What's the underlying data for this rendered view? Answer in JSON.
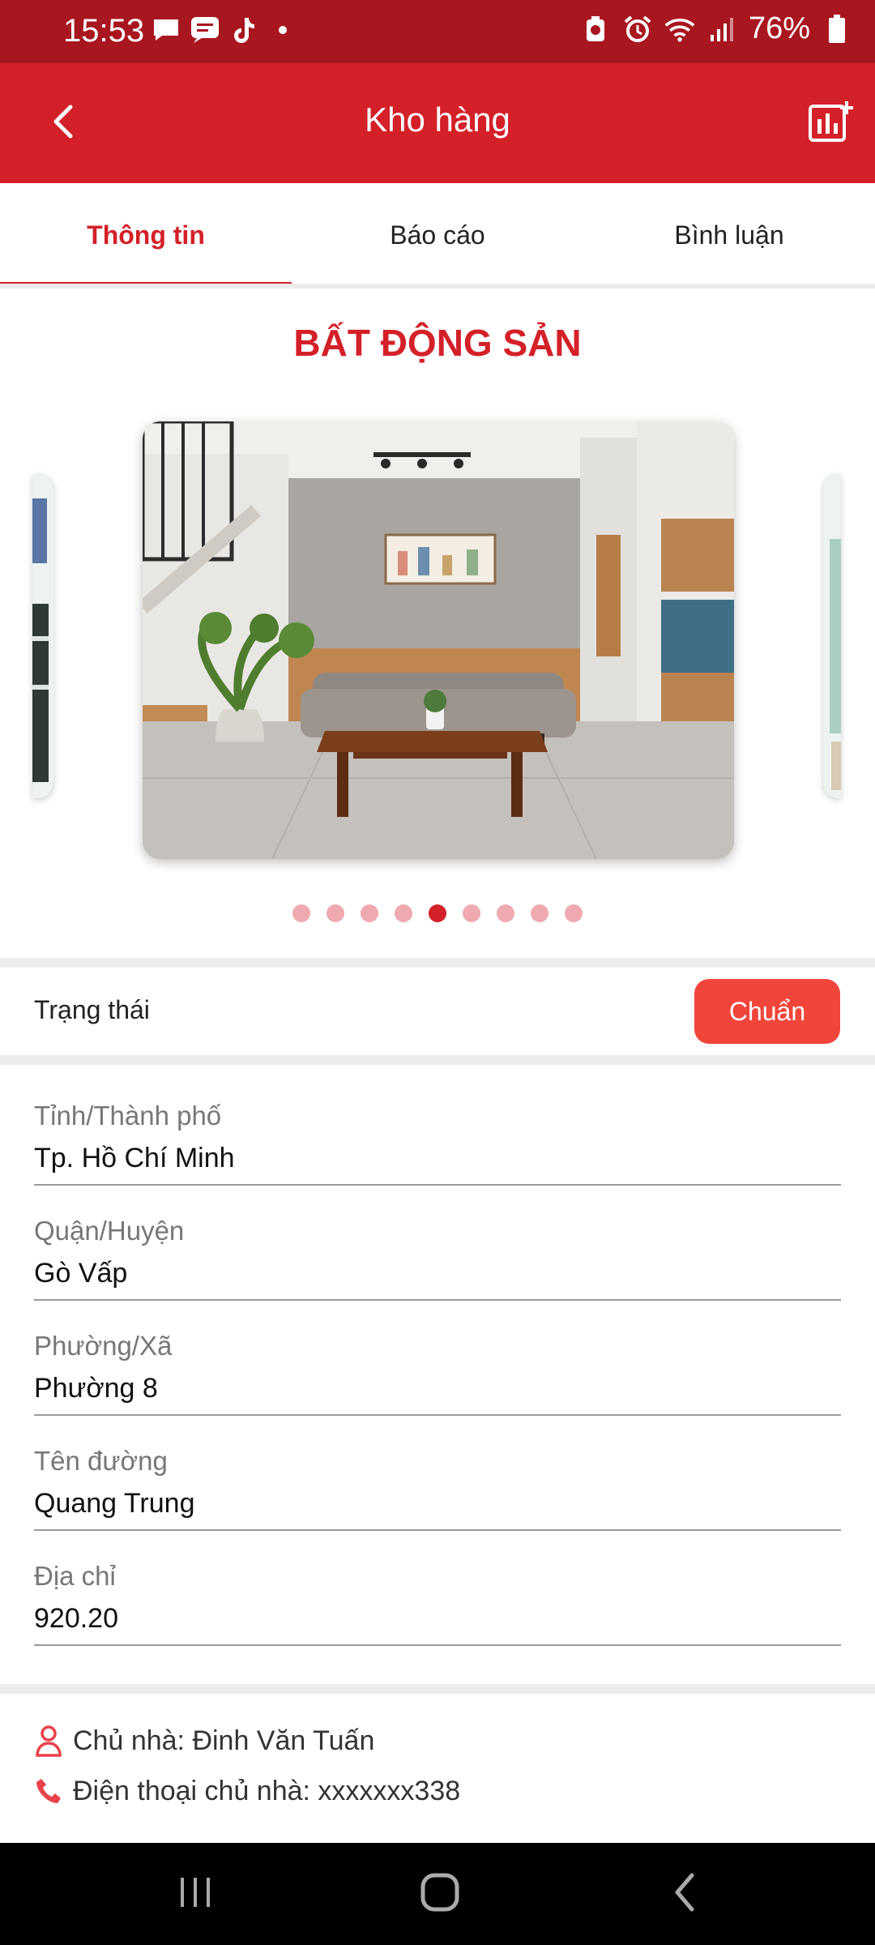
{
  "status_bar": {
    "time": "15:53",
    "battery_percent": "76%",
    "left_icons": [
      "chat-bubble-icon",
      "message-icon",
      "tiktok-icon",
      "dot-icon"
    ],
    "right_icons": [
      "battery-saver-icon",
      "alarm-icon",
      "wifi-icon",
      "signal-icon",
      "battery-icon"
    ]
  },
  "app_bar": {
    "title": "Kho hàng",
    "back_icon": "chevron-left-icon",
    "action_icon": "add-chart-icon",
    "color": "#d42028"
  },
  "tabs": [
    {
      "label": "Thông tin",
      "active": true
    },
    {
      "label": "Báo cáo",
      "active": false
    },
    {
      "label": "Bình luận",
      "active": false
    }
  ],
  "section_title": "BẤT ĐỘNG SẢN",
  "carousel": {
    "total_slides": 9,
    "active_index": 4
  },
  "status": {
    "label": "Trạng thái",
    "value": "Chuẩn",
    "color": "#f1453b"
  },
  "fields": [
    {
      "label": "Tỉnh/Thành phố",
      "value": "Tp. Hồ Chí Minh"
    },
    {
      "label": "Quận/Huyện",
      "value": "Gò Vấp"
    },
    {
      "label": "Phường/Xã",
      "value": "Phường 8"
    },
    {
      "label": "Tên đường",
      "value": "Quang Trung"
    },
    {
      "label": "Địa chỉ",
      "value": "920.20"
    }
  ],
  "owner": {
    "name_text": "Chủ nhà: Đinh Văn Tuấn",
    "phone_text": "Điện thoại chủ nhà: xxxxxxx338",
    "icon_color": "#e8434b"
  },
  "nav_bar": {
    "buttons": [
      "recent-apps-icon",
      "home-icon",
      "back-icon"
    ]
  }
}
